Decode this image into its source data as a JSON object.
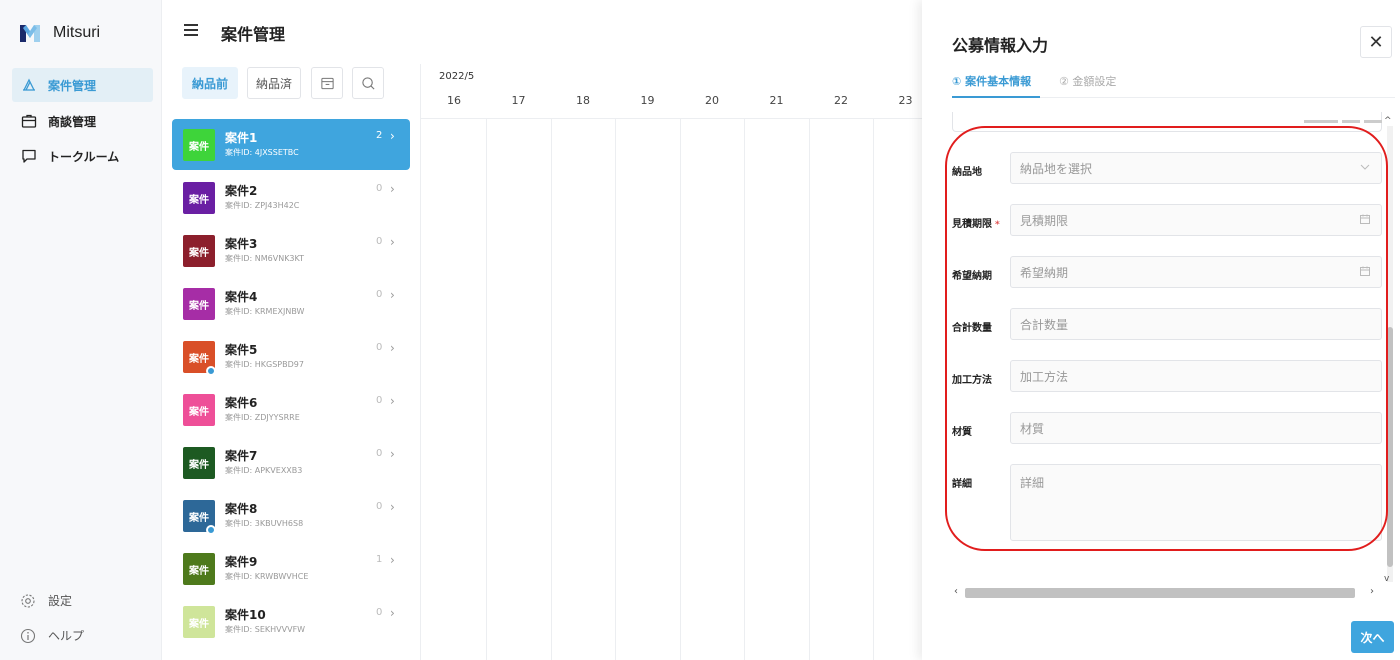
{
  "app": {
    "name": "Mitsuri"
  },
  "sidebar": {
    "items": [
      {
        "label": "案件管理",
        "icon": "deal-icon",
        "active": true
      },
      {
        "label": "商談管理",
        "icon": "briefcase-icon",
        "active": false
      },
      {
        "label": "トークルーム",
        "icon": "chat-icon",
        "active": false
      }
    ],
    "bottom": [
      {
        "label": "設定",
        "icon": "gear-icon"
      },
      {
        "label": "ヘルプ",
        "icon": "info-icon"
      }
    ]
  },
  "header": {
    "title": "案件管理"
  },
  "toolbar": {
    "tab_before": "納品前",
    "tab_after": "納品済"
  },
  "projects": [
    {
      "name": "案件1",
      "id": "案件ID: 4JXSSETBC",
      "count": "2",
      "color": "#3ed43a",
      "thumb": "案件",
      "dot": false
    },
    {
      "name": "案件2",
      "id": "案件ID: ZPJ43H42C",
      "count": "0",
      "color": "#6a1fa3",
      "thumb": "案件",
      "dot": false
    },
    {
      "name": "案件3",
      "id": "案件ID: NM6VNK3KT",
      "count": "0",
      "color": "#8c1f2c",
      "thumb": "案件",
      "dot": false
    },
    {
      "name": "案件4",
      "id": "案件ID: KRMEXJNBW",
      "count": "0",
      "color": "#a62da6",
      "thumb": "案件",
      "dot": false
    },
    {
      "name": "案件5",
      "id": "案件ID: HKGSPBD97",
      "count": "0",
      "color": "#d94f28",
      "thumb": "案件",
      "dot": true
    },
    {
      "name": "案件6",
      "id": "案件ID: ZDJYYSRRE",
      "count": "0",
      "color": "#ee4f98",
      "thumb": "案件",
      "dot": false
    },
    {
      "name": "案件7",
      "id": "案件ID: APKVEXXB3",
      "count": "0",
      "color": "#1d5a22",
      "thumb": "案件",
      "dot": false
    },
    {
      "name": "案件8",
      "id": "案件ID: 3KBUVH6S8",
      "count": "0",
      "color": "#2d6898",
      "thumb": "案件",
      "dot": true
    },
    {
      "name": "案件9",
      "id": "案件ID: KRWBWVHCE",
      "count": "1",
      "color": "#4e7a1c",
      "thumb": "案件",
      "dot": false
    },
    {
      "name": "案件10",
      "id": "案件ID: SEKHVVVFW",
      "count": "0",
      "color": "#cfe59a",
      "thumb": "案件",
      "dot": false
    }
  ],
  "calendar": {
    "month": "2022/5",
    "days": [
      "16",
      "17",
      "18",
      "19",
      "20",
      "21",
      "22",
      "23"
    ]
  },
  "panel": {
    "title": "公募情報入力",
    "close": "✕",
    "steps": [
      {
        "label": "① 案件基本情報",
        "active": true
      },
      {
        "label": "② 金額設定",
        "active": false
      }
    ],
    "fields": [
      {
        "label": "納品地",
        "placeholder": "納品地を選択",
        "required": false,
        "trail": "chevron-down-icon"
      },
      {
        "label": "見積期限",
        "placeholder": "見積期限",
        "required": true,
        "trail": "calendar-icon"
      },
      {
        "label": "希望納期",
        "placeholder": "希望納期",
        "required": false,
        "trail": "calendar-icon"
      },
      {
        "label": "合計数量",
        "placeholder": "合計数量",
        "required": false,
        "trail": ""
      },
      {
        "label": "加工方法",
        "placeholder": "加工方法",
        "required": false,
        "trail": ""
      },
      {
        "label": "材質",
        "placeholder": "材質",
        "required": false,
        "trail": ""
      },
      {
        "label": "詳細",
        "placeholder": "詳細",
        "required": false,
        "trail": ""
      }
    ],
    "required_mark": "*",
    "next_label": "次へ"
  },
  "colors": {
    "accent": "#3fa5de",
    "highlight": "#e11d1d"
  }
}
